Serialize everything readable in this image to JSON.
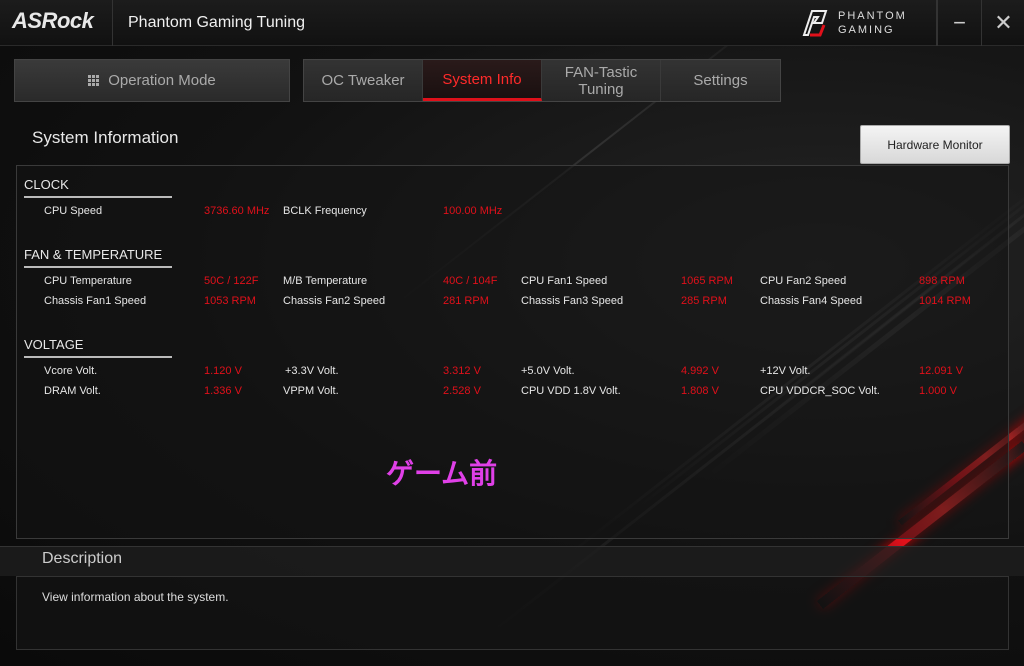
{
  "app": {
    "brand": "ASRock",
    "title": "Phantom Gaming Tuning",
    "logo_line1": "PHANTOM",
    "logo_line2": "GAMING",
    "minimize": "−",
    "close": "✕"
  },
  "nav": {
    "operation_mode": "Operation Mode",
    "tabs": [
      {
        "label": "OC Tweaker",
        "active": false
      },
      {
        "label": "System Info",
        "active": true
      },
      {
        "label": "FAN-Tastic Tuning",
        "active": false
      },
      {
        "label": "Settings",
        "active": false
      }
    ]
  },
  "section": {
    "title": "System Information",
    "hardware_monitor_button": "Hardware Monitor"
  },
  "groups": {
    "clock": {
      "heading": "CLOCK",
      "rows": [
        [
          {
            "label": "CPU Speed",
            "value": "3736.60 MHz"
          },
          {
            "label": "BCLK Frequency",
            "value": "100.00 MHz"
          }
        ]
      ]
    },
    "fan": {
      "heading": "FAN & TEMPERATURE",
      "rows": [
        [
          {
            "label": "CPU Temperature",
            "value": "50C / 122F"
          },
          {
            "label": "M/B Temperature",
            "value": "40C / 104F"
          },
          {
            "label": "CPU Fan1 Speed",
            "value": "1065 RPM"
          },
          {
            "label": "CPU Fan2 Speed",
            "value": "898 RPM"
          }
        ],
        [
          {
            "label": "Chassis Fan1 Speed",
            "value": "1053 RPM"
          },
          {
            "label": "Chassis Fan2 Speed",
            "value": "281 RPM"
          },
          {
            "label": "Chassis Fan3 Speed",
            "value": "285 RPM"
          },
          {
            "label": "Chassis Fan4 Speed",
            "value": "1014 RPM"
          }
        ]
      ]
    },
    "voltage": {
      "heading": "VOLTAGE",
      "rows": [
        [
          {
            "label": "Vcore Volt.",
            "value": "1.120 V"
          },
          {
            "label": "+3.3V Volt.",
            "value": "3.312 V"
          },
          {
            "label": "+5.0V Volt.",
            "value": "4.992 V"
          },
          {
            "label": "+12V Volt.",
            "value": "12.091 V"
          }
        ],
        [
          {
            "label": "DRAM Volt.",
            "value": "1.336 V"
          },
          {
            "label": "VPPM Volt.",
            "value": "2.528 V"
          },
          {
            "label": "CPU VDD 1.8V Volt.",
            "value": "1.808 V"
          },
          {
            "label": "CPU VDDCR_SOC Volt.",
            "value": "1.000 V"
          }
        ]
      ]
    }
  },
  "overlay_text": "ゲーム前",
  "description": {
    "title": "Description",
    "text": "View information about the system."
  },
  "colors": {
    "accent_red": "#e0101a",
    "overlay_magenta": "#e040e8"
  }
}
